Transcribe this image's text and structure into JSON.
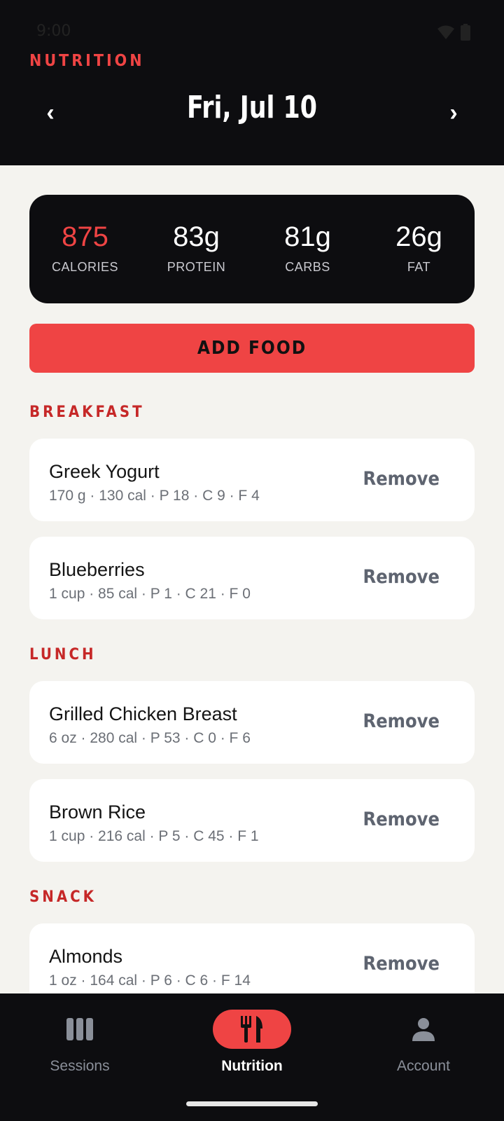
{
  "status": {
    "time": "9:00"
  },
  "header": {
    "eyebrow": "NUTRITION",
    "date": "Fri, Jul 10",
    "prev_glyph": "‹",
    "next_glyph": "›"
  },
  "summary": {
    "calories": {
      "value": "875",
      "label": "CALORIES"
    },
    "protein": {
      "value": "83g",
      "label": "PROTEIN"
    },
    "carbs": {
      "value": "81g",
      "label": "CARBS"
    },
    "fat": {
      "value": "26g",
      "label": "FAT"
    }
  },
  "add_button": "ADD FOOD",
  "meals": {
    "breakfast": {
      "label": "BREAKFAST",
      "items": [
        {
          "name": "Greek Yogurt",
          "detail": "170 g · 130 cal · P 18 · C 9 · F 4",
          "action": "Remove"
        },
        {
          "name": "Blueberries",
          "detail": "1 cup · 85 cal · P 1 · C 21 · F 0",
          "action": "Remove"
        }
      ]
    },
    "lunch": {
      "label": "LUNCH",
      "items": [
        {
          "name": "Grilled Chicken Breast",
          "detail": "6 oz · 280 cal · P 53 · C 0 · F 6",
          "action": "Remove"
        },
        {
          "name": "Brown Rice",
          "detail": "1 cup · 216 cal · P 5 · C 45 · F 1",
          "action": "Remove"
        }
      ]
    },
    "snack": {
      "label": "SNACK",
      "items": [
        {
          "name": "Almonds",
          "detail": "1 oz · 164 cal · P 6 · C 6 · F 14",
          "action": "Remove"
        }
      ]
    }
  },
  "bottom_nav": {
    "items": [
      {
        "label": "Sessions",
        "icon": "sessions-icon",
        "active": false
      },
      {
        "label": "Nutrition",
        "icon": "fork-knife-icon",
        "active": true
      },
      {
        "label": "Account",
        "icon": "person-icon",
        "active": false
      }
    ]
  },
  "colors": {
    "accent": "#ef4444",
    "meal_label": "#c62828",
    "dark": "#0d0d10",
    "background": "#f4f3ef"
  }
}
